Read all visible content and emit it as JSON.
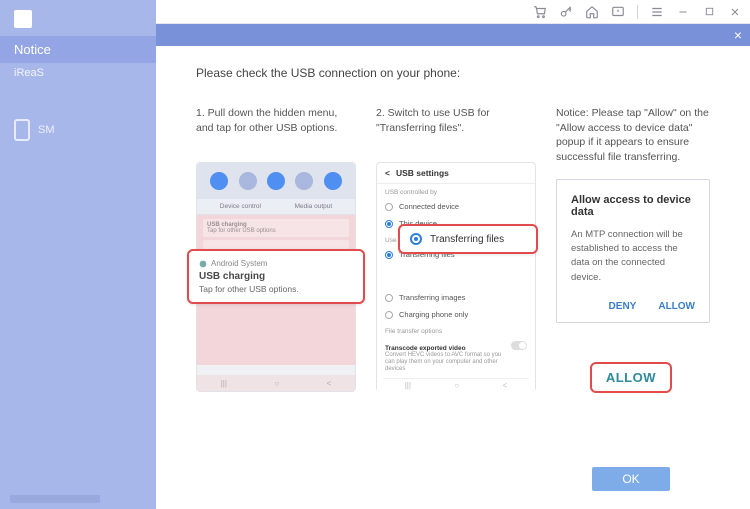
{
  "titlebar": {
    "icons": {
      "cart": "cart-icon",
      "key": "key-icon",
      "home": "home-icon",
      "feedback": "feedback-icon",
      "menu": "menu-icon",
      "min": "minimize-icon",
      "max": "maximize-icon",
      "close": "close-icon"
    }
  },
  "sidebar": {
    "brand": "iReaS",
    "notice_label": "Notice",
    "sms_label": "SM"
  },
  "notice_header": {
    "close": "×"
  },
  "content": {
    "heading": "Please check the USB connection on your phone:",
    "step1": {
      "text": "1. Pull down the hidden menu, and tap for other USB options.",
      "panel": {
        "device_control": "Device control",
        "media_output": "Media output",
        "usb_charging": "USB charging",
        "tap_other": "Tap for other USB options"
      },
      "callout": {
        "system": "Android System",
        "title": "USB charging",
        "sub": "Tap for other USB options."
      }
    },
    "step2": {
      "text": "2. Switch to use USB for \"Transferring files\".",
      "panel": {
        "title": "USB settings",
        "sec1": "USB controlled by",
        "opt_connected": "Connected device",
        "opt_this": "This device",
        "sec2": "Use USB for",
        "opt_tf": "Transferring files",
        "opt_ti": "Transferring images",
        "opt_co": "Charging phone only",
        "sec3": "File transfer options",
        "tr_title": "Transcode exported video",
        "tr_sub": "Convert HEVC videos to AVC format so you can play them on your computer and other devices"
      },
      "callout": "Transferring files"
    },
    "step3": {
      "text": "Notice: Please tap \"Allow\" on the \"Allow access to device data\" popup if it appears to ensure successful file transferring.",
      "dialog": {
        "title": "Allow access to device data",
        "body": "An MTP connection will be established to access the data on the connected device.",
        "deny": "DENY",
        "allow": "ALLOW"
      },
      "callout": "ALLOW"
    },
    "ok": "OK"
  }
}
